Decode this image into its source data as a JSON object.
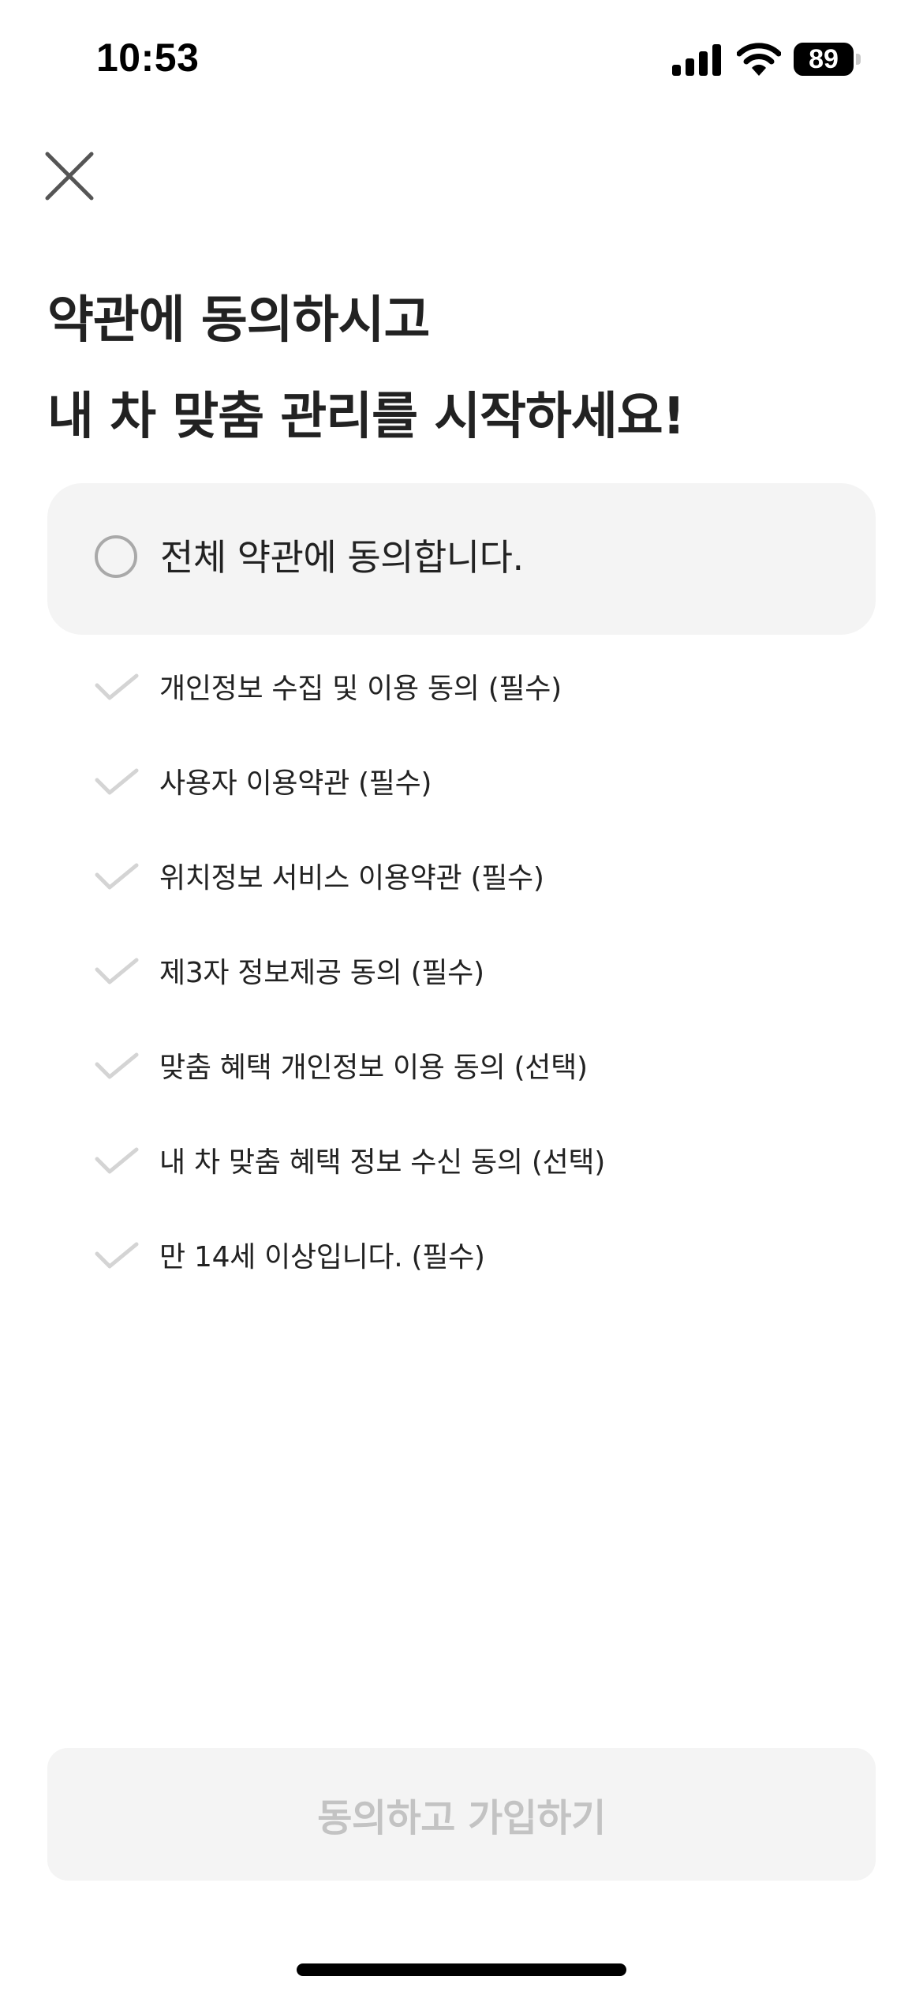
{
  "status_bar": {
    "time": "10:53",
    "battery_level": "89",
    "icons": [
      "signal-icon",
      "wifi-icon",
      "battery-icon"
    ]
  },
  "header": {
    "close_icon": "close-icon",
    "title_line1": "약관에 동의하시고",
    "title_line2": "내 차 맞춤 관리를 시작하세요!"
  },
  "agree_all": {
    "label": "전체 약관에 동의합니다.",
    "checked": false
  },
  "terms": [
    {
      "label": "개인정보 수집 및 이용 동의 (필수)",
      "checked": false
    },
    {
      "label": "사용자 이용약관 (필수)",
      "checked": false
    },
    {
      "label": "위치정보 서비스 이용약관 (필수)",
      "checked": false
    },
    {
      "label": "제3자 정보제공 동의 (필수)",
      "checked": false
    },
    {
      "label": "맞춤 혜택 개인정보 이용 동의 (선택)",
      "checked": false
    },
    {
      "label": "내 차 맞춤 혜택 정보 수신 동의 (선택)",
      "checked": false
    },
    {
      "label": "만 14세 이상입니다. (필수)",
      "checked": false
    }
  ],
  "submit": {
    "label": "동의하고 가입하기",
    "enabled": false
  },
  "colors": {
    "background": "#ffffff",
    "card": "#f4f4f4",
    "text": "#222222",
    "check_unchecked": "#d4d4d4",
    "radio_border": "#a9a9a9",
    "button_disabled_text": "#c3c3c3"
  }
}
